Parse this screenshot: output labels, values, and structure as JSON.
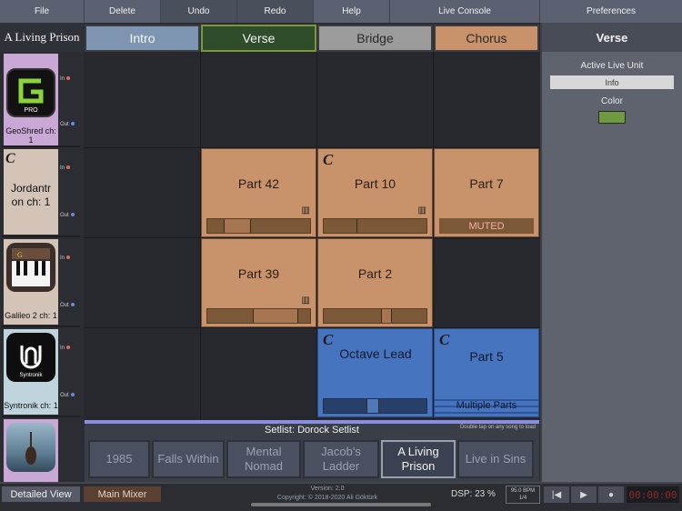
{
  "menu": {
    "file": "File",
    "delete": "Delete",
    "undo": "Undo",
    "redo": "Redo",
    "help": "Help",
    "live_console": "Live Console",
    "preferences": "Preferences"
  },
  "song_title": "A Living Prison",
  "sections": [
    "Intro",
    "Verse",
    "Bridge",
    "Chorus"
  ],
  "right_panel": {
    "title": "Verse",
    "active_live_unit_label": "Active Live Unit",
    "active_live_unit_value": "Info",
    "color_label": "Color",
    "color_value": "#6f9a3e"
  },
  "channels": [
    {
      "name": "GeoShred ch: 1",
      "in": "In",
      "out": "Out",
      "icon": "geoshred-icon"
    },
    {
      "name": "Jordantr on ch: 1",
      "letter": "C",
      "in": "In",
      "out": "Out"
    },
    {
      "name": "Galileo 2 ch: 1",
      "in": "In",
      "out": "Out",
      "icon": "galileo-icon"
    },
    {
      "name": "Syntronik ch: 1",
      "in": "In",
      "out": "Out",
      "icon": "syntronik-icon"
    },
    {
      "name": "",
      "icon": "violin-photo-icon"
    }
  ],
  "parts": {
    "p42": {
      "name": "Part 42"
    },
    "p10": {
      "name": "Part 10",
      "letter": "C"
    },
    "p7": {
      "name": "Part 7",
      "status": "MUTED"
    },
    "p39": {
      "name": "Part 39"
    },
    "p2": {
      "name": "Part 2"
    },
    "octave": {
      "name": "Octave Lead",
      "letter": "C"
    },
    "p5": {
      "name": "Part 5",
      "letter": "C",
      "status": "Multiple Parts"
    }
  },
  "setlist": {
    "title": "Setlist: Dorock Setlist",
    "hint": "Double tap on any song to load",
    "songs": [
      "1985",
      "Falls Within",
      "Mental Nomad",
      "Jacob's Ladder",
      "A Living Prison",
      "Live in Sins"
    ],
    "active_song": "A Living Prison"
  },
  "bottom": {
    "detailed_view": "Detailed View",
    "main_mixer": "Main Mixer",
    "version": "Version: 2.0",
    "copyright": "Copyright: © 2018-2020 Ali Göktürk",
    "dsp": "DSP: 23 %",
    "bpm": "95.0 BPM",
    "time_sig": "1/4",
    "timer": "00:00:00"
  },
  "colors": {
    "part_orange": "#c8926a",
    "part_blue": "#4674bf",
    "verse_border": "#7a9a3a"
  }
}
